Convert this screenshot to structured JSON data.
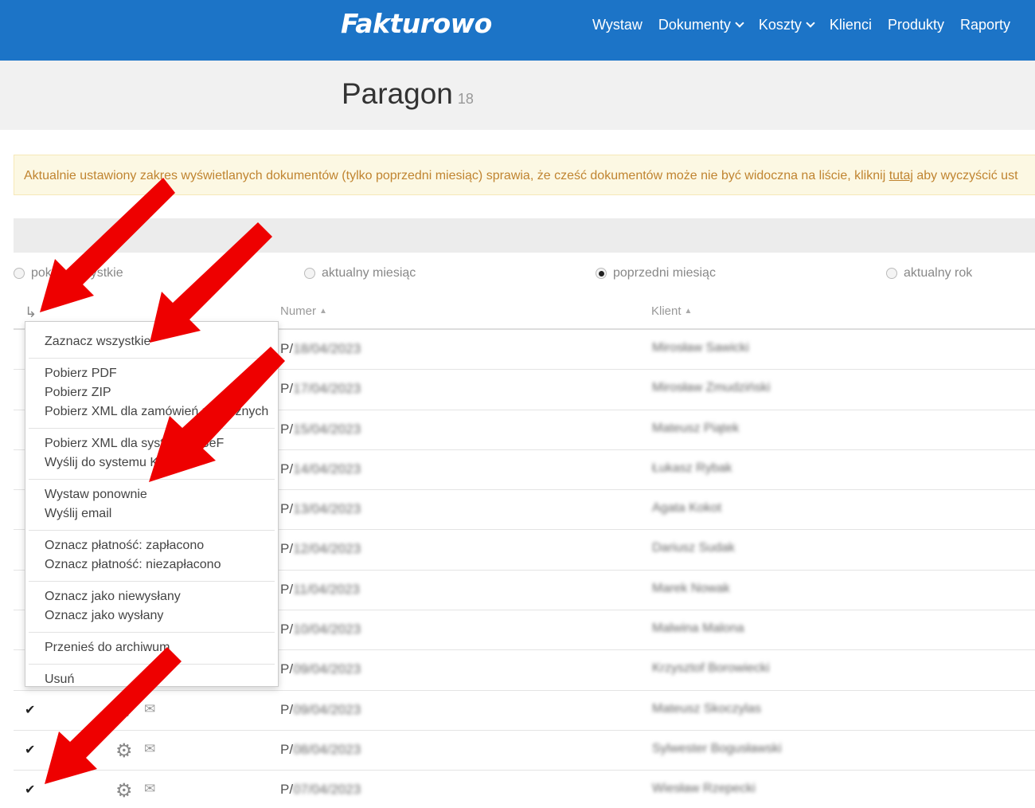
{
  "header": {
    "logo": "Fakturowo",
    "nav": [
      {
        "label": "Wystaw",
        "has_dropdown": false
      },
      {
        "label": "Dokumenty",
        "has_dropdown": true
      },
      {
        "label": "Koszty",
        "has_dropdown": true
      },
      {
        "label": "Klienci",
        "has_dropdown": false
      },
      {
        "label": "Produkty",
        "has_dropdown": false
      },
      {
        "label": "Raporty",
        "has_dropdown": false
      }
    ]
  },
  "page": {
    "title": "Paragon",
    "count": "18"
  },
  "alert": {
    "text_before": "Aktualnie ustawiony zakres wyświetlanych dokumentów (tylko poprzedni miesiąc) sprawia, że cześć dokumentów może nie być widoczna na liście, kliknij ",
    "link": "tutaj",
    "text_after": " aby wyczyścić ust"
  },
  "filters": {
    "options": [
      {
        "label": "pokaż wszystkie",
        "checked": false
      },
      {
        "label": "aktualny miesiąc",
        "checked": false
      },
      {
        "label": "poprzedni miesiąc",
        "checked": true
      },
      {
        "label": "aktualny rok",
        "checked": false
      }
    ]
  },
  "table": {
    "columns": {
      "number": "Numer",
      "client": "Klient"
    },
    "rows": [
      {
        "checked": true,
        "number_prefix": "P/",
        "number": "18/04/2023",
        "client": "Mirosław Sawicki"
      },
      {
        "checked": true,
        "number_prefix": "P/",
        "number": "17/04/2023",
        "client": "Mirosław Zmudziński"
      },
      {
        "checked": true,
        "number_prefix": "P/",
        "number": "15/04/2023",
        "client": "Mateusz Piątek"
      },
      {
        "checked": true,
        "number_prefix": "P/",
        "number": "14/04/2023",
        "client": "Łukasz Rybak"
      },
      {
        "checked": true,
        "number_prefix": "P/",
        "number": "13/04/2023",
        "client": "Agata Kokot"
      },
      {
        "checked": true,
        "number_prefix": "P/",
        "number": "12/04/2023",
        "client": "Dariusz Sudak"
      },
      {
        "checked": true,
        "number_prefix": "P/",
        "number": "11/04/2023",
        "client": "Marek Nowak"
      },
      {
        "checked": true,
        "number_prefix": "P/",
        "number": "10/04/2023",
        "client": "Malwina Malona"
      },
      {
        "checked": true,
        "number_prefix": "P/",
        "number": "09/04/2023",
        "client": "Krzysztof Borowiecki"
      },
      {
        "checked": true,
        "number_prefix": "P/",
        "number": "09/04/2023",
        "client": "Mateusz Skoczylas"
      },
      {
        "checked": true,
        "number_prefix": "P/",
        "number": "08/04/2023",
        "client": "Sylwester Bogusławski"
      },
      {
        "checked": true,
        "number_prefix": "P/",
        "number": "07/04/2023",
        "client": "Wiesław Rzepecki"
      }
    ]
  },
  "dropdown": {
    "groups": [
      [
        "Zaznacz wszystkie"
      ],
      [
        "Pobierz PDF",
        "Pobierz ZIP",
        "Pobierz XML dla zamówień publicznych"
      ],
      [
        "Pobierz XML dla systemu KSeF",
        "Wyślij do systemu KSeF"
      ],
      [
        "Wystaw ponownie",
        "Wyślij email"
      ],
      [
        "Oznacz płatność: zapłacono",
        "Oznacz płatność: niezapłacono"
      ],
      [
        "Oznacz jako niewysłany",
        "Oznacz jako wysłany"
      ],
      [
        "Przenieś do archiwum"
      ],
      [
        "Usuń"
      ]
    ]
  },
  "colors": {
    "header_bg": "#1c74c7",
    "arrow": "#ee0000",
    "alert_text": "#c08430"
  }
}
